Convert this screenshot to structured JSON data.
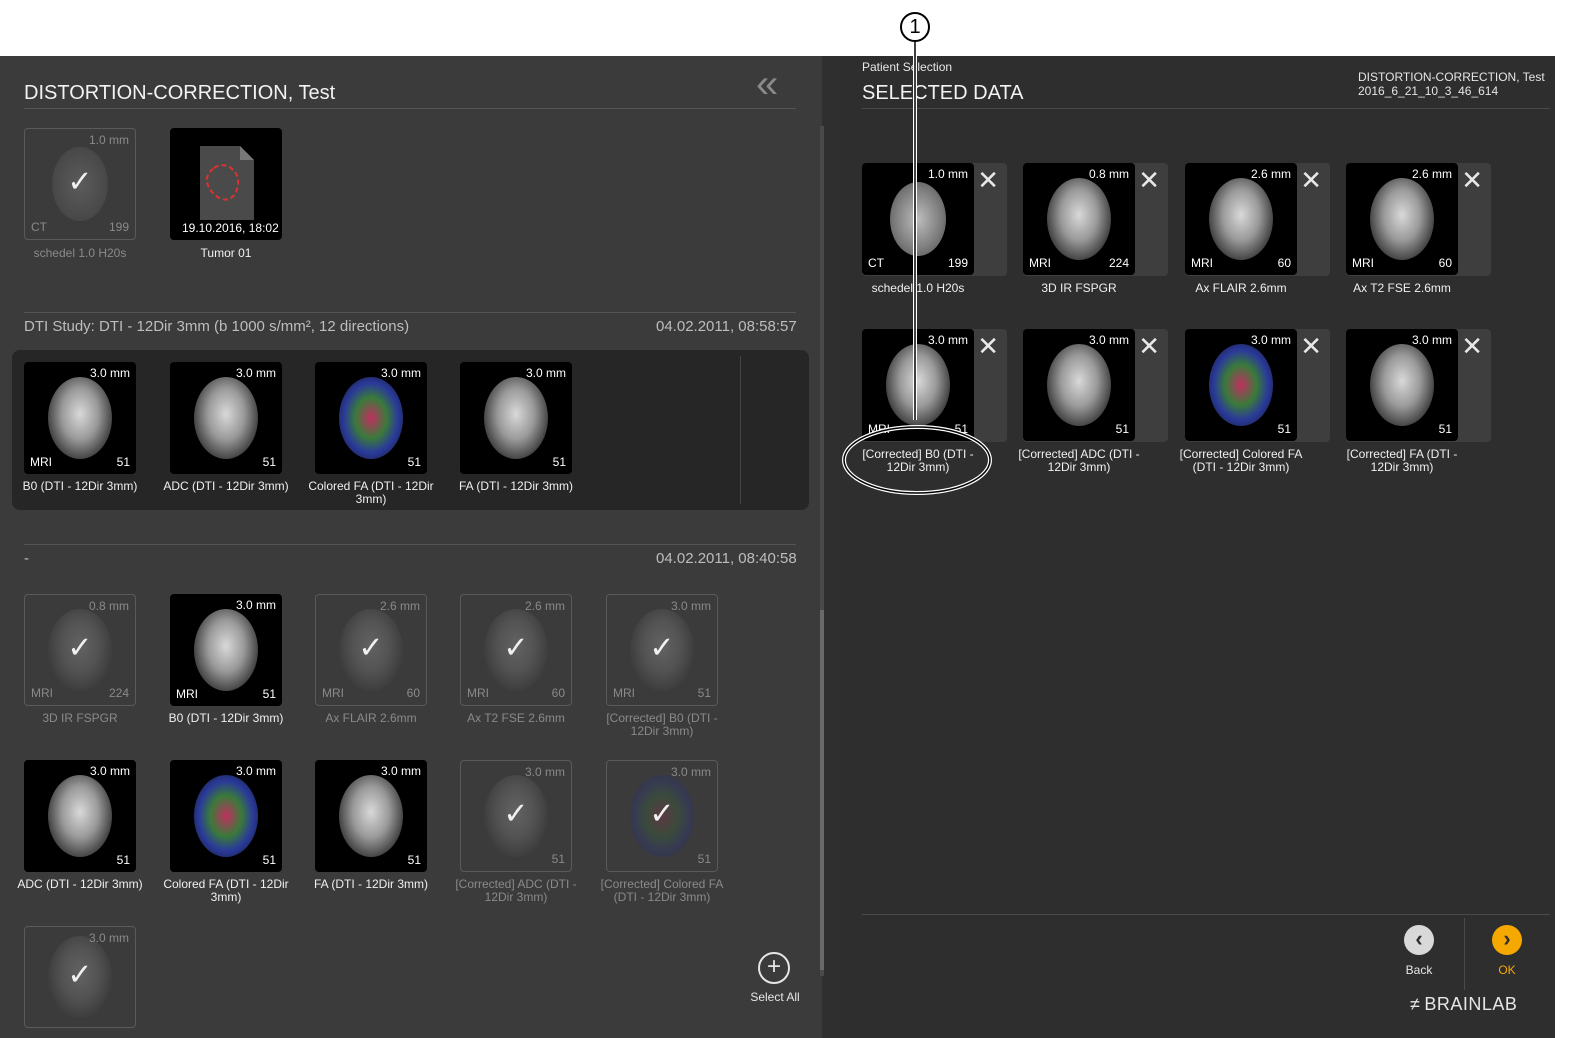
{
  "callout": {
    "number": "1"
  },
  "left": {
    "patient_title": "DISTORTION-CORRECTION, Test",
    "collapse_icon": "double-chevron-left",
    "top_items": [
      {
        "mm": "1.0 mm",
        "modality": "CT",
        "count": "199",
        "caption": "schedel 1.0 H20s",
        "selected": true,
        "kind": "ct"
      },
      {
        "date": "19.10.2016, 18:02",
        "caption": "Tumor 01",
        "kind": "object"
      }
    ],
    "study1": {
      "title": "DTI Study: DTI - 12Dir 3mm (b 1000 s/mm², 12 directions)",
      "date": "04.02.2011, 08:58:57",
      "items": [
        {
          "mm": "3.0 mm",
          "modality": "MRI",
          "count": "51",
          "caption": "B0 (DTI - 12Dir 3mm)"
        },
        {
          "mm": "3.0 mm",
          "modality": "",
          "count": "51",
          "caption": "ADC (DTI - 12Dir 3mm)"
        },
        {
          "mm": "3.0 mm",
          "modality": "",
          "count": "51",
          "caption": "Colored FA (DTI - 12Dir 3mm)"
        },
        {
          "mm": "3.0 mm",
          "modality": "",
          "count": "51",
          "caption": "FA (DTI - 12Dir 3mm)"
        }
      ]
    },
    "study2": {
      "title": "-",
      "date": "04.02.2011, 08:40:58",
      "items": [
        {
          "mm": "0.8 mm",
          "modality": "MRI",
          "count": "224",
          "caption": "3D IR FSPGR",
          "selected": true
        },
        {
          "mm": "3.0 mm",
          "modality": "MRI",
          "count": "51",
          "caption": "B0 (DTI - 12Dir 3mm)",
          "selected": false
        },
        {
          "mm": "2.6 mm",
          "modality": "MRI",
          "count": "60",
          "caption": "Ax FLAIR 2.6mm",
          "selected": true
        },
        {
          "mm": "2.6 mm",
          "modality": "MRI",
          "count": "60",
          "caption": "Ax T2 FSE 2.6mm",
          "selected": true
        },
        {
          "mm": "3.0 mm",
          "modality": "MRI",
          "count": "51",
          "caption": "[Corrected] B0 (DTI - 12Dir 3mm)",
          "selected": true
        },
        {
          "mm": "3.0 mm",
          "modality": "",
          "count": "51",
          "caption": "ADC (DTI - 12Dir 3mm)",
          "selected": false
        },
        {
          "mm": "3.0 mm",
          "modality": "",
          "count": "51",
          "caption": "Colored FA (DTI - 12Dir 3mm)",
          "selected": false
        },
        {
          "mm": "3.0 mm",
          "modality": "",
          "count": "51",
          "caption": "FA (DTI - 12Dir 3mm)",
          "selected": false
        },
        {
          "mm": "3.0 mm",
          "modality": "",
          "count": "51",
          "caption": "[Corrected] ADC (DTI - 12Dir 3mm)",
          "selected": true
        },
        {
          "mm": "3.0 mm",
          "modality": "",
          "count": "51",
          "caption": "[Corrected] Colored FA (DTI - 12Dir 3mm)",
          "selected": true
        },
        {
          "mm": "3.0 mm",
          "modality": "",
          "count": "",
          "caption": "",
          "selected": true
        }
      ]
    },
    "select_all_label": "Select All"
  },
  "right": {
    "breadcrumb": "Patient Selection",
    "title": "SELECTED DATA",
    "patient_name": "DISTORTION-CORRECTION, Test",
    "session_id": "2016_6_21_10_3_46_614",
    "remove_icon": "close-icon",
    "selected": [
      {
        "mm": "1.0 mm",
        "modality": "CT",
        "count": "199",
        "caption": "schedel 1.0 H20s"
      },
      {
        "mm": "0.8 mm",
        "modality": "MRI",
        "count": "224",
        "caption": "3D IR FSPGR"
      },
      {
        "mm": "2.6 mm",
        "modality": "MRI",
        "count": "60",
        "caption": "Ax FLAIR 2.6mm"
      },
      {
        "mm": "2.6 mm",
        "modality": "MRI",
        "count": "60",
        "caption": "Ax T2 FSE 2.6mm"
      },
      {
        "mm": "3.0 mm",
        "modality": "MRI",
        "count": "51",
        "caption": "[Corrected] B0 (DTI - 12Dir 3mm)"
      },
      {
        "mm": "3.0 mm",
        "modality": "",
        "count": "51",
        "caption": "[Corrected] ADC (DTI - 12Dir 3mm)"
      },
      {
        "mm": "3.0 mm",
        "modality": "",
        "count": "51",
        "caption": "[Corrected] Colored FA (DTI - 12Dir 3mm)"
      },
      {
        "mm": "3.0 mm",
        "modality": "",
        "count": "51",
        "caption": "[Corrected] FA (DTI - 12Dir 3mm)"
      }
    ],
    "back_label": "Back",
    "ok_label": "OK",
    "brand": "BRAINLAB",
    "colors": {
      "ok_accent": "#f5a800",
      "back_button": "#d9d9d9"
    }
  }
}
